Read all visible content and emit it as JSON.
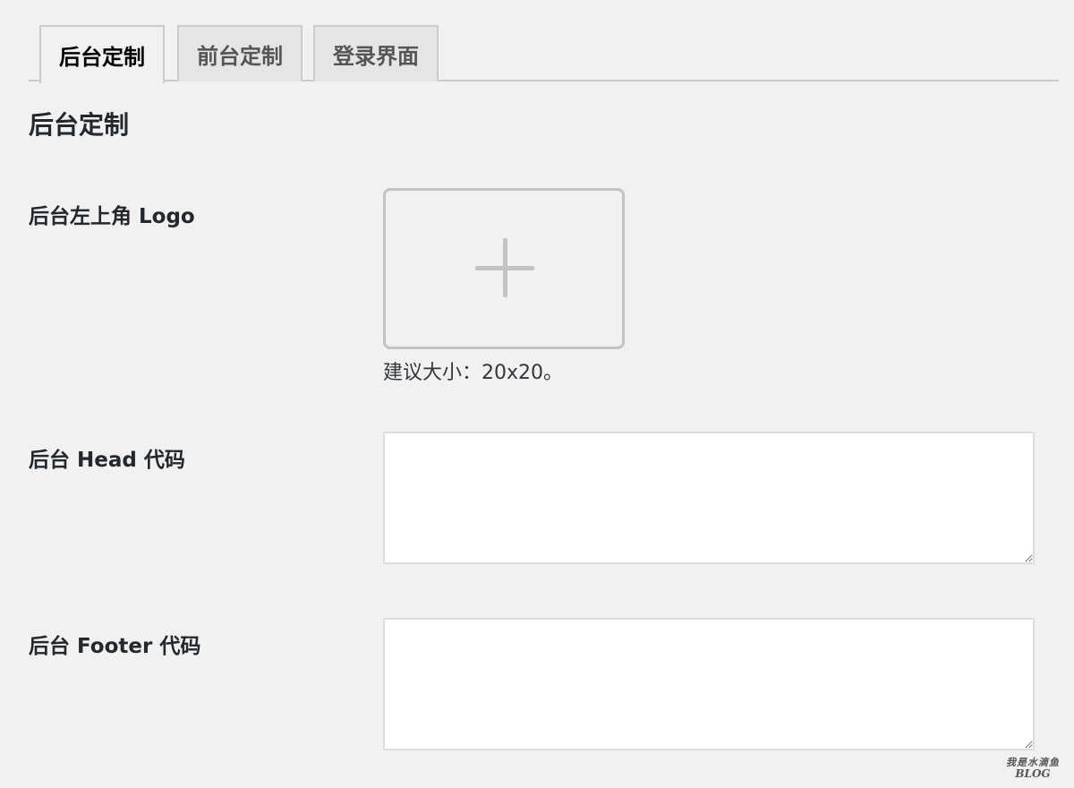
{
  "tabs": [
    {
      "label": "后台定制",
      "active": true
    },
    {
      "label": "前台定制",
      "active": false
    },
    {
      "label": "登录界面",
      "active": false
    }
  ],
  "section": {
    "title": "后台定制"
  },
  "fields": {
    "logo": {
      "label": "后台左上角 Logo",
      "upload_icon": "plus-icon",
      "hint": "建议大小：20x20。"
    },
    "head_code": {
      "label": "后台 Head 代码",
      "value": ""
    },
    "footer_code": {
      "label": "后台 Footer 代码",
      "value": ""
    }
  },
  "watermark": {
    "line1": "我是水滴鱼",
    "line2": "BLOG"
  },
  "colors": {
    "background": "#f1f1f1",
    "active_tab_text": "#000000",
    "inactive_tab_bg": "#e5e5e5",
    "border": "#cccccc",
    "upload_border": "#c3c3c3"
  }
}
